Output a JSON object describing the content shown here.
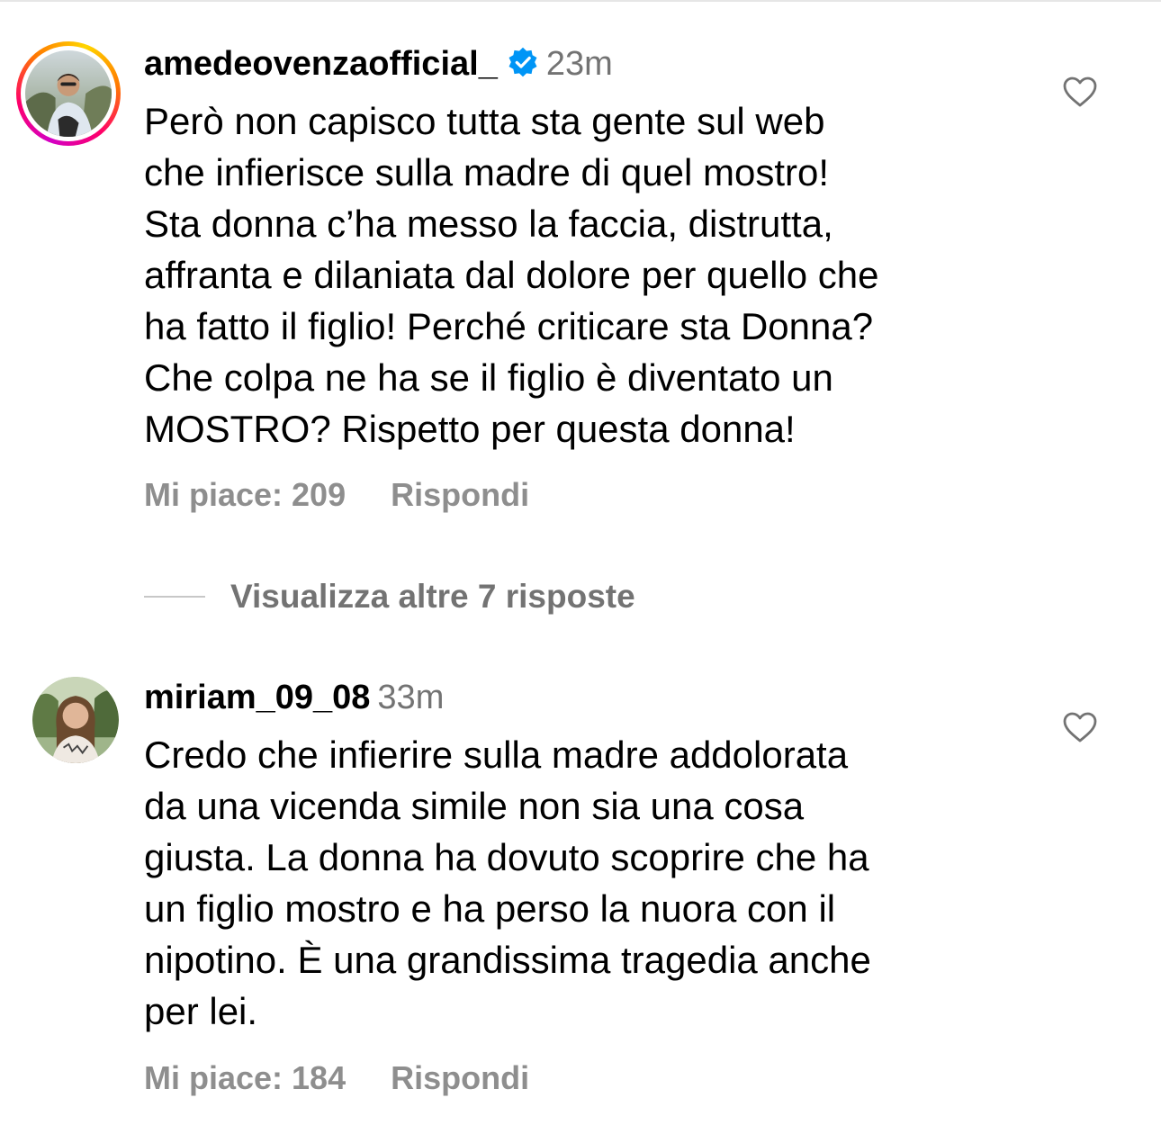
{
  "comments": [
    {
      "username": "amedeovenzaofficial_",
      "verified": true,
      "time": "23m",
      "text": "Però non capisco tutta sta gente sul web\nche infierisce sulla madre di quel mostro!\nSta donna c’ha messo la faccia, distrutta,\naffranta e dilaniata dal dolore per quello che\nha fatto il figlio! Perché criticare sta Donna?\nChe colpa ne ha se il figlio è diventato un\nMOSTRO? Rispetto per questa donna!",
      "likes": "Mi piace: 209",
      "reply": "Rispondi",
      "has_story_ring": true
    },
    {
      "username": "miriam_09_08",
      "verified": false,
      "time": "33m",
      "text": "Credo che infierire sulla madre addolorata\nda una vicenda simile non sia una cosa\ngiusta. La donna ha dovuto scoprire che ha\nun figlio mostro e  ha perso  la nuora con il\nnipotino. È una grandissima tragedia anche\nper lei.",
      "likes": "Mi piace: 184",
      "reply": "Rispondi",
      "has_story_ring": false
    }
  ],
  "more_replies": "Visualizza altre 7 risposte",
  "icons": {
    "verified": "verified-badge-icon",
    "like": "heart-outline-icon"
  },
  "colors": {
    "verified_blue": "#0095f6",
    "secondary_text": "#737373"
  }
}
